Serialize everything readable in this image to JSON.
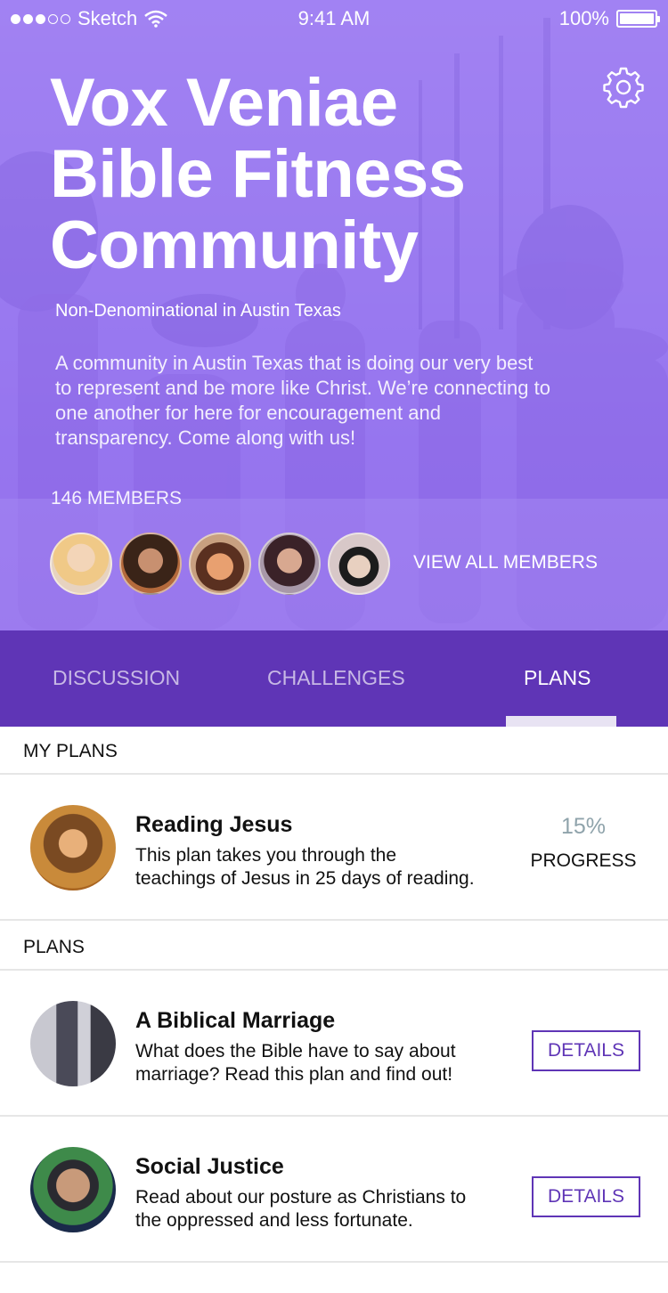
{
  "status_bar": {
    "carrier": "Sketch",
    "time": "9:41 AM",
    "battery": "100%"
  },
  "hero": {
    "title_lines": [
      "Vox Veniae",
      "Bible Fitness",
      "Community"
    ],
    "subtitle": "Non-Denominational in Austin Texas",
    "description_lines": [
      "A community in Austin Texas that is doing our very best",
      "to represent and be more like Christ. We’re connecting to",
      "one another for here for encouragement and",
      "transparency. Come along with us!"
    ],
    "members_count": "146 MEMBERS",
    "view_all_label": "VIEW ALL MEMBERS",
    "settings_icon": "gear-icon"
  },
  "tabs": [
    {
      "label": "DISCUSSION",
      "active": false
    },
    {
      "label": "CHALLENGES",
      "active": false
    },
    {
      "label": "PLANS",
      "active": true
    }
  ],
  "my_plans": {
    "heading": "MY PLANS",
    "items": [
      {
        "title": "Reading Jesus",
        "description_lines": [
          "This plan takes you through the",
          "teachings of Jesus in 25 days of reading."
        ],
        "progress_value": "15%",
        "progress_label": "PROGRESS"
      }
    ]
  },
  "plans": {
    "heading": "PLANS",
    "items": [
      {
        "title": "A Biblical Marriage",
        "description_lines": [
          "What does the Bible have to say about",
          "marriage? Read this plan and find out!"
        ],
        "button_label": "DETAILS"
      },
      {
        "title": "Social Justice",
        "description_lines": [
          "Read about our posture as Christians to",
          "the oppressed and less fortunate."
        ],
        "button_label": "DETAILS"
      }
    ]
  },
  "colors": {
    "hero_purple": "#9a79f2",
    "tab_bar": "#5f35b6",
    "accent": "#5f35b6",
    "progress_text": "#8fa3ab"
  }
}
